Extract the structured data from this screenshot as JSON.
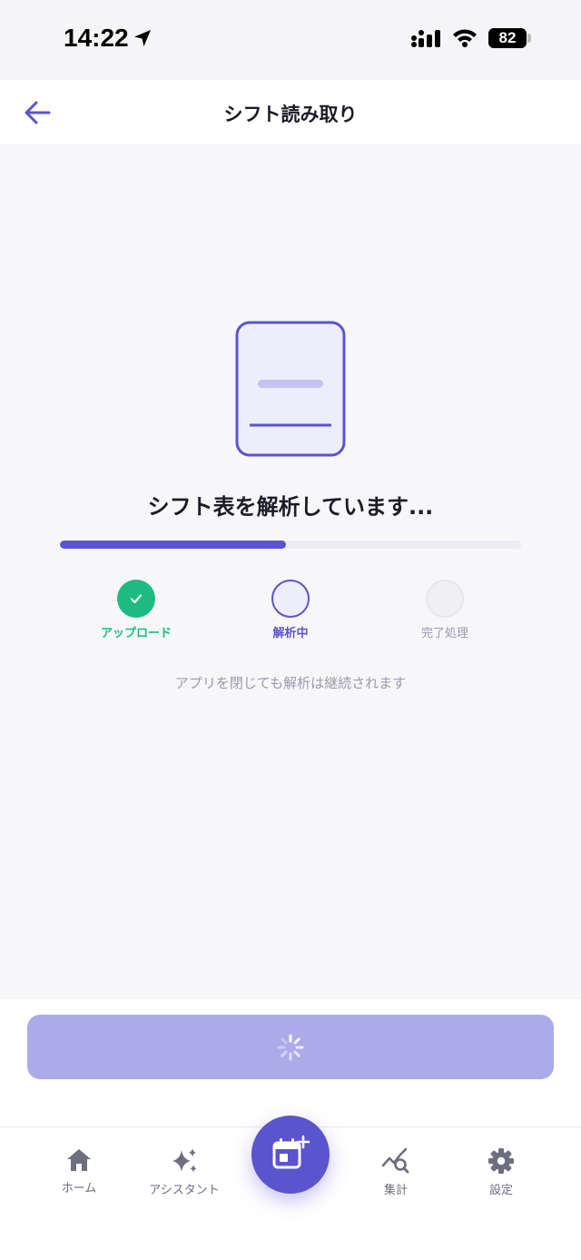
{
  "status_bar": {
    "time": "14:22",
    "battery": "82"
  },
  "header": {
    "title": "シフト読み取り"
  },
  "analysis": {
    "heading": "シフト表を解析しています...",
    "progress": 0.49,
    "steps": [
      {
        "label": "アップロード",
        "state": "done"
      },
      {
        "label": "解析中",
        "state": "active"
      },
      {
        "label": "完了処理",
        "state": "pending"
      }
    ],
    "note": "アプリを閉じても解析は継続されます"
  },
  "colors": {
    "accent": "#5b54cf",
    "success": "#1dbb82",
    "button_disabled": "#ababea"
  },
  "tab_bar": {
    "items": [
      {
        "label": "ホーム",
        "icon": "home-icon"
      },
      {
        "label": "アシスタント",
        "icon": "sparkles-icon"
      },
      {
        "label": "集計",
        "icon": "chart-search-icon"
      },
      {
        "label": "設定",
        "icon": "gear-icon"
      }
    ],
    "fab_icon": "calendar-add-icon"
  }
}
